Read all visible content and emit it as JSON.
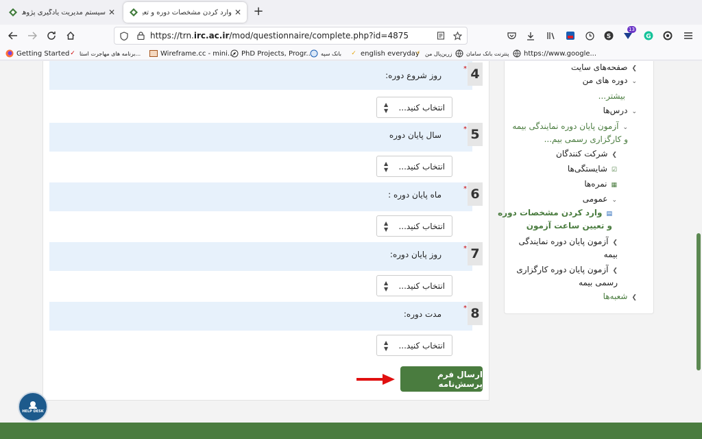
{
  "browser": {
    "tabs": [
      {
        "title": "سیستم مدیریت یادگیری پژوهشکده بیمه",
        "active": false
      },
      {
        "title": "وارد کردن مشخصات دوره و تعیین ساعت",
        "active": true
      }
    ],
    "close_glyph": "✕",
    "newtab_glyph": "+",
    "url_prefix": "https://trn.",
    "url_domain": "irc.ac.ir",
    "url_path": "/mod/questionnaire/complete.php?id=4875",
    "extension_badge": "13",
    "bookmarks": [
      {
        "label": "Getting Started",
        "icon": "firefox-icon"
      },
      {
        "label": "برنامه های مهاجرت استا...",
        "icon": "bookmark-icon"
      },
      {
        "label": "Wireframe.cc - mini...",
        "icon": "wireframe-icon"
      },
      {
        "label": "PhD Projects, Progr...",
        "icon": "compass-icon"
      },
      {
        "label": "بانک سپه",
        "icon": "bank-icon"
      },
      {
        "label": "english everyday",
        "icon": "check-icon"
      },
      {
        "label": "زرین‌پال من",
        "icon": "zarinpal-icon"
      },
      {
        "label": "پنترنت بانک سامان",
        "icon": "globe-icon"
      },
      {
        "label": "https://www.google...",
        "icon": "globe-icon"
      }
    ]
  },
  "questions": [
    {
      "number": "4",
      "label": "روز شروع دوره:",
      "select": "انتخاب کنید..."
    },
    {
      "number": "5",
      "label": "سال پایان دوره",
      "select": "انتخاب کنید..."
    },
    {
      "number": "6",
      "label": "ماه پایان دوره :",
      "select": "انتخاب کنید..."
    },
    {
      "number": "7",
      "label": "روز پایان دوره:",
      "select": "انتخاب کنید..."
    },
    {
      "number": "8",
      "label": "مدت دوره:",
      "select": "انتخاب کنید..."
    }
  ],
  "required_mark": "*",
  "submit_label": "ارسال فرم پرسش‌نامه",
  "sidebar": {
    "site_pages": "صفحه‌های سایت",
    "my_courses": "دوره های من",
    "more": "بیشتر...",
    "lessons": "درس‌ها",
    "exam_line1": "آزمون پایان دوره نمایندگی بیمه",
    "exam_line2": "و کارگزاری رسمی بیم...",
    "participants": "شرکت کنندگان",
    "competencies": "شایستگی‌ها",
    "grades": "نمره‌ها",
    "general": "عمومی",
    "current_line1": "وارد کردن مشخصات دوره",
    "current_line2": "و تعیین ساعت آزمون",
    "exam_agency_line1": "آزمون پایان دوره نمایندگی",
    "exam_agency_line2": "بیمه",
    "exam_broker_line1": "آزمون پایان دوره کارگزاری",
    "exam_broker_line2": "رسمی بیمه",
    "branches": "شعبه‌ها"
  },
  "helpdesk_label": "HELP DESK",
  "colors": {
    "accent": "#4a7c3f",
    "question_bg": "#e7f1fb",
    "required": "#cc0000",
    "arrow": "#e01010"
  }
}
